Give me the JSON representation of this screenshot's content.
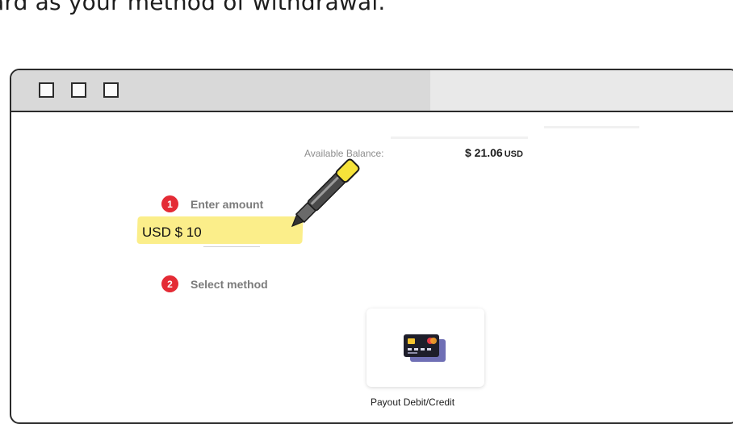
{
  "intro_text": "ard as your method of withdrawal.",
  "balance": {
    "label": "Available Balance:",
    "amount": "$ 21.06",
    "currency": "USD"
  },
  "steps": [
    {
      "number": "1",
      "label": "Enter amount"
    },
    {
      "number": "2",
      "label": "Select method"
    }
  ],
  "amount_input": {
    "value": "USD $  10"
  },
  "methods": [
    {
      "label": "Payout Debit/Credit",
      "icon": "credit-card-icon"
    }
  ],
  "colors": {
    "step_badge": "#e42b35",
    "highlight": "#fbee8a",
    "pen_yellow": "#f6e33a"
  }
}
